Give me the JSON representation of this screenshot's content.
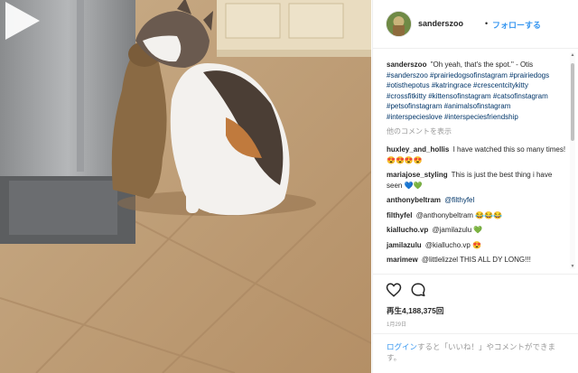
{
  "post": {
    "username": "sanderszoo",
    "separator": "•",
    "follow_label": "フォローする"
  },
  "caption": {
    "user": "sanderszoo",
    "text": "\"Oh yeah, that's the spot.\" - Otis",
    "hashtags": "#sanderszoo #prairiedogsofinstagram #prairiedogs #otisthepotus #katringrace #crescentcitykitty #crossfitkitty #kittensofinstagram #catsofinstagram #petsofinstagram #animalsofinstagram #interspecieslove #interspeciesfriendship"
  },
  "more_comments_label": "他のコメントを表示",
  "comments": [
    {
      "user": "huxley_and_hollis",
      "text": "I have watched this so many times! 😍😍😍😍"
    },
    {
      "user": "mariajose_styling",
      "text": "This is just the best thing i have seen 💙💚"
    },
    {
      "user": "anthonybeltram",
      "text": "@filthyfel"
    },
    {
      "user": "filthyfel",
      "text": "@anthonybeltram 😂😂😂"
    },
    {
      "user": "kiallucho.vp",
      "text": "@jamilazulu 💚"
    },
    {
      "user": "jamilazulu",
      "text": "@kiallucho.vp 😍"
    },
    {
      "user": "marimew",
      "text": "@littlelizzel THIS ALL DY LONG!!!"
    }
  ],
  "stats": {
    "views": "再生4,188,375回",
    "date": "1月29日"
  },
  "footer": {
    "login_link": "ログイン",
    "rest": "すると「いいね！」やコメントができます。"
  },
  "icons": {
    "like": "heart-icon",
    "comment": "comment-icon",
    "play": "play-icon"
  },
  "colors": {
    "link_blue": "#3897f0",
    "hashtag": "#003569",
    "muted": "#999999"
  }
}
